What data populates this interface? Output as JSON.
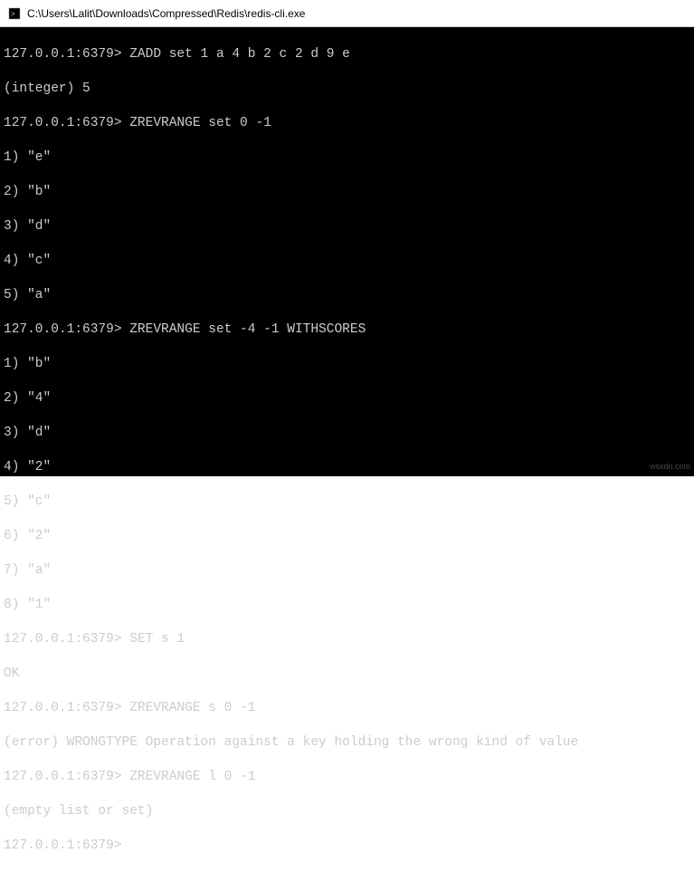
{
  "titlebar": {
    "path": "C:\\Users\\Lalit\\Downloads\\Compressed\\Redis\\redis-cli.exe"
  },
  "terminal": {
    "prompt": "127.0.0.1:6379>",
    "lines": [
      "127.0.0.1:6379> ZADD set 1 a 4 b 2 c 2 d 9 e",
      "(integer) 5",
      "127.0.0.1:6379> ZREVRANGE set 0 -1",
      "1) \"e\"",
      "2) \"b\"",
      "3) \"d\"",
      "4) \"c\"",
      "5) \"a\"",
      "127.0.0.1:6379> ZREVRANGE set -4 -1 WITHSCORES",
      "1) \"b\"",
      "2) \"4\"",
      "3) \"d\"",
      "4) \"2\"",
      "5) \"c\"",
      "6) \"2\"",
      "7) \"a\"",
      "8) \"1\"",
      "127.0.0.1:6379> SET s 1",
      "OK",
      "127.0.0.1:6379> ZREVRANGE s 0 -1",
      "(error) WRONGTYPE Operation against a key holding the wrong kind of value",
      "127.0.0.1:6379> ZREVRANGE l 0 -1",
      "(empty list or set)",
      "127.0.0.1:6379>"
    ]
  },
  "watermark": "wsxdn.com"
}
